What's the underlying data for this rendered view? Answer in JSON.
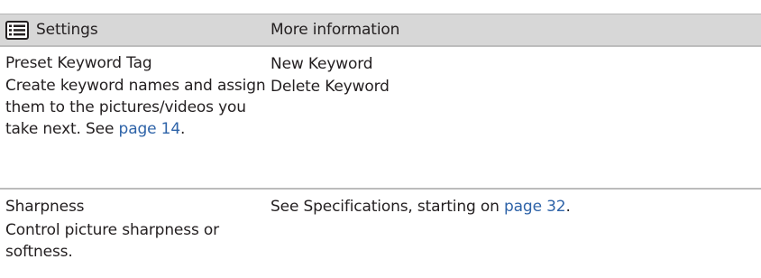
{
  "header": {
    "settings_label": "Settings",
    "more_info_label": "More information"
  },
  "rows": [
    {
      "title": "Preset Keyword Tag",
      "description": "Create keyword names and assign them to the pictures/videos you take next.",
      "see_prefix": "See",
      "link": "page 14",
      "after_link": ".",
      "more_info": [
        "New Keyword",
        "Delete Keyword"
      ]
    },
    {
      "title": "Sharpness",
      "description": "Control picture sharpness or softness.",
      "more_info_prefix": "See Specifications, starting on",
      "link": "page 32",
      "after_link": "."
    }
  ]
}
